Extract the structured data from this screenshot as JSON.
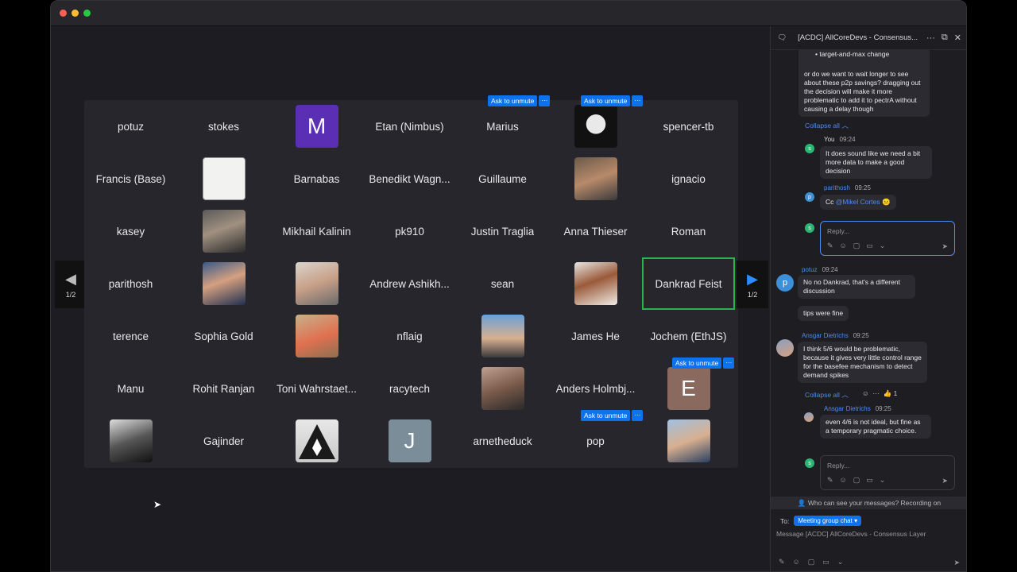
{
  "chat": {
    "title": "[ACDC] AllCoreDevs - Consensus...",
    "bullet": "target-and-max change",
    "msg1": "or do we want to wait longer to see about these p2p savings? dragging out the decision will make it more problematic to add it to pectrA without causing a delay though",
    "collapse_all": "Collapse all",
    "you_name": "You",
    "you_time": "09:24",
    "you_msg": "It does sound like we need a bit more data to make a good decision",
    "parithosh_name": "parithosh",
    "parithosh_time": "09:25",
    "parithosh_msg_prefix": "Cc ",
    "parithosh_mention": "@Mikel Cortes",
    "reply_placeholder": "Reply...",
    "potuz_name": "potuz",
    "potuz_time": "09:24",
    "potuz_msg1": "No no Dankrad, that's a different discussion",
    "potuz_msg2": "tips were fine",
    "ansgar_name": "Ansgar Dietrichs",
    "ansgar_time": "09:25",
    "ansgar_msg": "I think 5/6 would be problematic, because it gives very little control range for the basefee mechanism to detect demand spikes",
    "reaction_count": "1",
    "ansgar_reply_name": "Ansgar Dietrichs",
    "ansgar_reply_time": "09:25",
    "ansgar_reply_msg": "even 4/6 is not ideal, but fine as a temporary pragmatic choice.",
    "privacy": "Who can see your messages? Recording on",
    "to_label": "To:",
    "to_value": "Meeting group chat",
    "message_placeholder": "Message [ACDC] AllCoreDevs - Consensus Layer"
  },
  "pager": {
    "left": "1/2",
    "right": "1/2"
  },
  "unmute": {
    "label": "Ask to unmute",
    "more": "···"
  },
  "participants": {
    "r1c1": "potuz",
    "r1c2": "stokes",
    "r1c3": "M",
    "r1c4": "Etan (Nimbus)",
    "r1c5": "Marius",
    "r1c7": "spencer-tb",
    "r2c1": "Francis (Base)",
    "r2c3": "Barnabas",
    "r2c4": "Benedikt Wagn...",
    "r2c5": "Guillaume",
    "r2c7": "ignacio",
    "r3c1": "kasey",
    "r3c3": "Mikhail Kalinin",
    "r3c4": "pk910",
    "r3c5": "Justin Traglia",
    "r3c6": "Anna Thieser",
    "r3c7": "Roman",
    "r4c1": "parithosh",
    "r4c4": "Andrew Ashikh...",
    "r4c5": "sean",
    "r4c7": "Dankrad Feist",
    "r5c1": "terence",
    "r5c2": "Sophia Gold",
    "r5c4": "nflaig",
    "r5c6": "James He",
    "r5c7": "Jochem (EthJS)",
    "r6c1": "Manu",
    "r6c2": "Rohit Ranjan",
    "r6c3": "Toni Wahrstaet...",
    "r6c4": "racytech",
    "r6c6": "Anders Holmbj...",
    "r6c7": "E",
    "r7c2": "Gajinder",
    "r7c4": "J",
    "r7c5": "arnetheduck",
    "r7c6": "pop"
  }
}
